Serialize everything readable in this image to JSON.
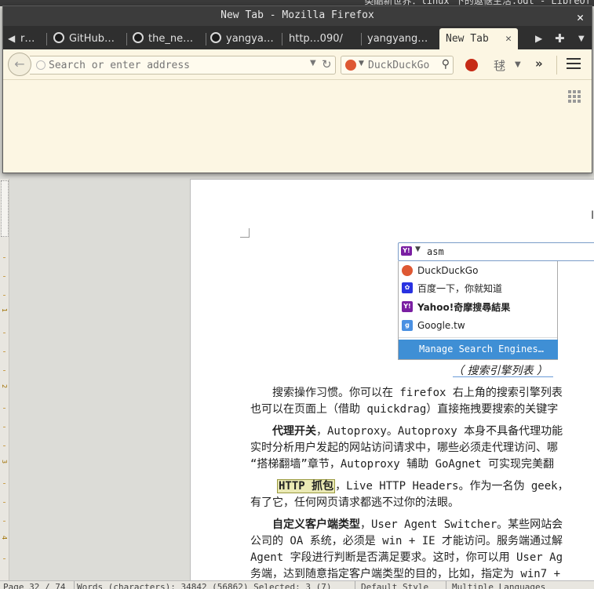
{
  "writer": {
    "title_fragment": "类酷新世界：linux 下的遨惬生活.odt - LibreOf",
    "caption": "（ 搜索引擎列表 ）",
    "ruler_numbers": [
      "1",
      "2",
      "3",
      "4"
    ],
    "paragraphs": [
      {
        "lead": "",
        "text": "　　搜索操作习惯。你可以在 firefox 右上角的搜索引擎列表"
      },
      {
        "lead": "",
        "text": "也可以在页面上（借助 quickdrag）直接拖拽要搜索的关键字"
      },
      {
        "lead": "　　代理开关",
        "text": "，Autoproxy。Autoproxy 本身不具备代理功能"
      },
      {
        "lead": "",
        "text": "实时分析用户发起的网站访问请求中，哪些必须走代理访问、哪"
      },
      {
        "lead": "",
        "text": "“搭梯翻墙”章节，Autoproxy 辅助 GoAgnet 可实现完美翻"
      },
      {
        "lead": "HTTP 抓包",
        "text": "，Live HTTP Headers。作为一名伪 geek，"
      },
      {
        "lead": "",
        "text": "有了它，任何网页请求都逃不过你的法眼。"
      },
      {
        "lead": "　　自定义客户端类型",
        "text": "，User Agent Switcher。某些网站会"
      },
      {
        "lead": "",
        "text": "公司的 OA 系统，必须是 win + IE 才能访问。服务端通过解"
      },
      {
        "lead": "",
        "text": "Agent 字段进行判断是否满足要求。这时，你可以用 User Ag"
      },
      {
        "lead": "",
        "text": "务端，达到随意指定客户端类型的目的，比如，指定为 win7 +"
      }
    ],
    "embedded_search": {
      "query": "asm",
      "engines": [
        {
          "label": "DuckDuckGo",
          "icon": "duckduckgo-icon",
          "bold": false
        },
        {
          "label": "百度一下，你就知道",
          "icon": "baidu-icon",
          "bold": false
        },
        {
          "label": "Yahoo!奇摩搜尋結果",
          "icon": "yahoo-icon",
          "bold": true
        },
        {
          "label": "Google.tw",
          "icon": "google-icon",
          "bold": false
        }
      ],
      "manage_label": "Manage Search Engines…"
    },
    "statusbar": {
      "page": "Page 32 / 74",
      "words": "Words (characters): 34842 (56862) Selected: 3 (7)",
      "style": "Default Style",
      "language": "Multiple Languages"
    }
  },
  "firefox": {
    "title": "New Tab - Mozilla Firefox",
    "tabs": [
      {
        "label": "r…",
        "icon": "none"
      },
      {
        "label": "GitHub…",
        "icon": "github-icon"
      },
      {
        "label": "the_ne…",
        "icon": "github-icon"
      },
      {
        "label": "yangya…",
        "icon": "github-icon"
      },
      {
        "label": "http…090/",
        "icon": "none"
      },
      {
        "label": "yangyang…",
        "icon": "none"
      }
    ],
    "active_tab": "New Tab",
    "url_placeholder": "Search or enter address",
    "search_placeholder": "DuckDuckGo",
    "colors": {
      "content_bg": "#fcf6e3",
      "tabbar_bg": "#2f2f2f",
      "titlebar_bg": "#3c3c3c"
    }
  }
}
